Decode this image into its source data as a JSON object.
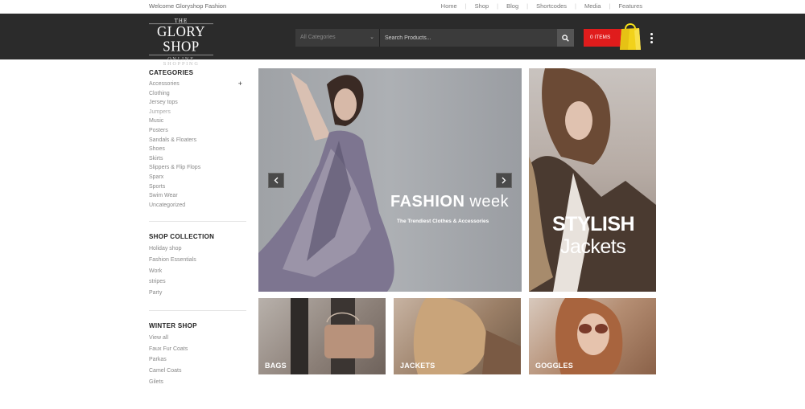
{
  "topbar": {
    "welcome": "Welcome Gloryshop Fashion",
    "nav": [
      "Home",
      "Shop",
      "Blog",
      "Shortcodes",
      "Media",
      "Features"
    ]
  },
  "header": {
    "logo": {
      "the": "THE",
      "name": "GLORY SHOP",
      "tagline": "ONLINE SHOPPING"
    },
    "search": {
      "category": "All Categories",
      "placeholder": "Search Products..."
    },
    "cart": {
      "label": "0 ITEMS"
    },
    "colors": {
      "header_bg": "#2b2b2b",
      "cart_red": "#e01c1c",
      "bag_yellow": "#f2d21b"
    }
  },
  "sidebar": {
    "categories": {
      "title": "CATEGORIES",
      "items": [
        "Accessories",
        "Clothing",
        "Jersey tops",
        "Jumpers",
        "Music",
        "Posters",
        "Sandals & Floaters",
        "Shoes",
        "Skirts",
        "Slippers & Flip Flops",
        "Sparx",
        "Sports",
        "Swim Wear",
        "Uncategorized"
      ]
    },
    "shop_collection": {
      "title": "SHOP COLLECTION",
      "items": [
        "Holiday shop",
        "Fashion Essentials",
        "Work",
        "stripes",
        "Party"
      ]
    },
    "winter_shop": {
      "title": "WINTER SHOP",
      "items": [
        "View all",
        "Faux Fur Coats",
        "Parkas",
        "Camel Coats",
        "Gilets"
      ]
    }
  },
  "banners": {
    "main": {
      "title_bold": "FASHION",
      "title_light": "week",
      "subtitle": "The Trendiest Clothes & Accessories"
    },
    "side": {
      "line1": "STYLISH",
      "line2": "Jackets"
    },
    "small": [
      "BAGS",
      "JACKETS",
      "GOGGLES"
    ]
  }
}
